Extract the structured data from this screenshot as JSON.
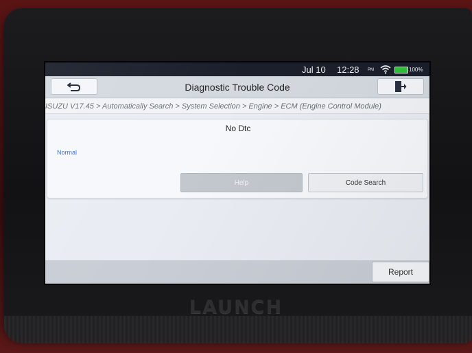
{
  "status_bar": {
    "date": "Jul 10",
    "time": "12:28",
    "ampm": "PM",
    "battery_percent": "100%",
    "battery_level": 1.0,
    "wifi_icon": "wifi-icon",
    "battery_color": "#2fc13a"
  },
  "header": {
    "title": "Diagnostic Trouble Code",
    "back_icon": "back-arrow-icon",
    "exit_icon": "exit-door-icon"
  },
  "breadcrumb": "ISUZU V17.45 > Automatically Search > System Selection > Engine > ECM (Engine Control Module)",
  "dtc": {
    "code": "No Dtc",
    "description": "Normal",
    "description_color": "#3b6fd4",
    "help_label": "Help",
    "code_search_label": "Code Search"
  },
  "footer": {
    "report_label": "Report"
  },
  "device": {
    "brand": "LAUNCH"
  }
}
